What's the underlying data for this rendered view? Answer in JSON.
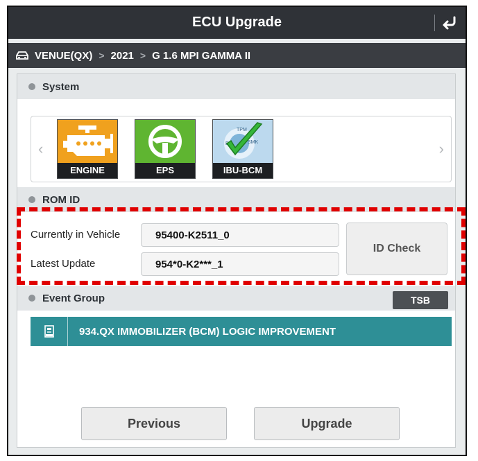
{
  "header": {
    "title": "ECU Upgrade",
    "back_icon": "return-arrow-icon"
  },
  "breadcrumb": {
    "icon": "car-icon",
    "items": [
      "VENUE(QX)",
      "2021",
      "G 1.6 MPI GAMMA II"
    ],
    "separator": ">"
  },
  "system": {
    "heading": "System",
    "tiles": [
      {
        "label": "ENGINE",
        "icon": "engine-icon",
        "color": "#f0a11e"
      },
      {
        "label": "EPS",
        "icon": "steering-wheel-icon",
        "color": "#5fb531"
      },
      {
        "label": "IBU-BCM",
        "icon": "bcm-check-icon",
        "color": "#7fb4d9",
        "tile_text": [
          "TPM",
          "B",
          "SMK"
        ]
      }
    ]
  },
  "rom": {
    "heading": "ROM ID",
    "current_label": "Currently in Vehicle",
    "current_value": "95400-K2511_0",
    "latest_label": "Latest Update",
    "latest_value": "954*0-K2***_1",
    "id_check_label": "ID Check"
  },
  "events": {
    "heading": "Event Group",
    "tsb_label": "TSB",
    "items": [
      {
        "title": "934.QX IMMOBILIZER (BCM) LOGIC IMPROVEMENT",
        "icon": "document-icon"
      }
    ]
  },
  "footer": {
    "previous_label": "Previous",
    "upgrade_label": "Upgrade"
  },
  "colors": {
    "titlebar": "#2f3237",
    "event_accent": "#2e8f96",
    "highlight_dashed": "#e00000"
  }
}
